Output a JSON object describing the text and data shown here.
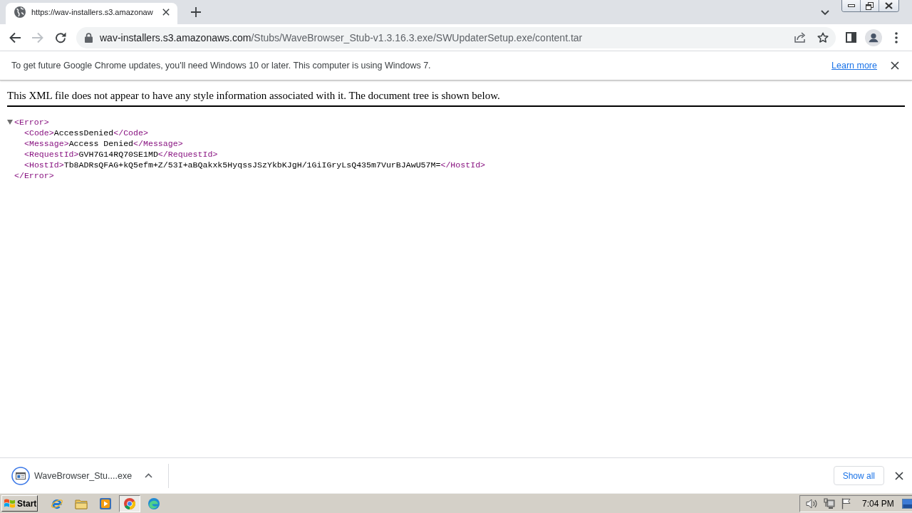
{
  "window": {
    "tabs": [
      {
        "title": "https://wav-installers.s3.amazonaw",
        "selected": true
      }
    ]
  },
  "toolbar": {
    "back": {
      "disabled": false
    },
    "forward": {
      "disabled": true
    },
    "address": {
      "host": "wav-installers.s3.amazonaws.com",
      "path": "/Stubs/WaveBrowser_Stub-v1.3.16.3.exe/SWUpdaterSetup.exe/content.tar"
    }
  },
  "infobar": {
    "message": "To get future Google Chrome updates, you'll need Windows 10 or later. This computer is using Windows 7.",
    "link": "Learn more"
  },
  "xml_viewer": {
    "notice": "This XML file does not appear to have any style information associated with it. The document tree is shown below.",
    "tree": {
      "open": "<Error>",
      "close": "</Error>",
      "expanded": true,
      "children": [
        {
          "open": "<Code>",
          "text": "AccessDenied",
          "close": "</Code>"
        },
        {
          "open": "<Message>",
          "text": "Access Denied",
          "close": "</Message>"
        },
        {
          "open": "<RequestId>",
          "text": "GVH7G14RQ70SE1MD",
          "close": "</RequestId>"
        },
        {
          "open": "<HostId>",
          "text": "Tb8ADRsQFAG+kQ5efm+Z/53I+aBQakxk5HyqssJSzYkbKJgH/1GiIGryLsQ435m7VurBJAwU57M=",
          "close": "</HostId>"
        }
      ]
    }
  },
  "download_shelf": {
    "items": [
      {
        "name": "WaveBrowser_Stu....exe"
      }
    ],
    "show_all": "Show all"
  },
  "taskbar": {
    "start": "Start",
    "apps": [
      {
        "kind": "ie",
        "selected": false
      },
      {
        "kind": "folder",
        "selected": false
      },
      {
        "kind": "media",
        "selected": false
      },
      {
        "kind": "chrome",
        "selected": true
      },
      {
        "kind": "edge",
        "selected": false
      }
    ],
    "clock": "7:04 PM"
  }
}
